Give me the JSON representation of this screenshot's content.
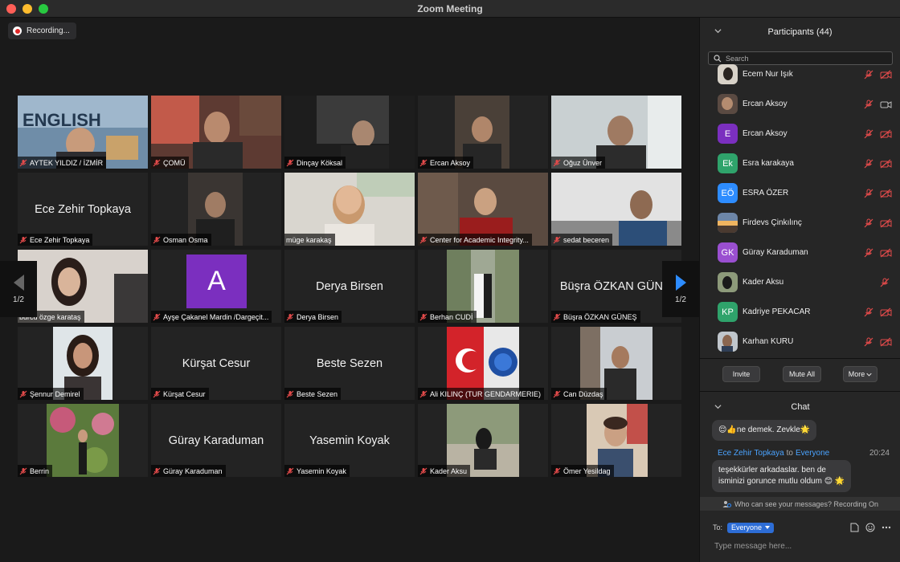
{
  "window": {
    "title": "Zoom Meeting"
  },
  "recording": {
    "label": "Recording..."
  },
  "pager": {
    "left_label": "1/2",
    "right_label": "1/2"
  },
  "colors": {
    "accent": "#2d8cff",
    "active_speaker": "#c6e06a",
    "avatar_purple": "#7b2fbf"
  },
  "tiles": [
    {
      "name": "AYTEK YILDIZ / İZMİR",
      "muted": true
    },
    {
      "name": "ÇOMÜ",
      "muted": true
    },
    {
      "name": "Dinçay Köksal",
      "muted": true
    },
    {
      "name": "Ercan Aksoy",
      "muted": true
    },
    {
      "name": "Oğuz Ünver",
      "muted": true
    },
    {
      "name": "Ece Zehir Topkaya",
      "display": "Ece Zehir Topkaya",
      "muted": true
    },
    {
      "name": "Osman Osma",
      "muted": true
    },
    {
      "name": "müge karakaş",
      "muted": false,
      "active": true
    },
    {
      "name": "Center for Academic Integrity...",
      "muted": true
    },
    {
      "name": "sedat beceren",
      "muted": true
    },
    {
      "name": "burcu özge karataş",
      "muted": false
    },
    {
      "name": "Ayşe Çakanel Mardin /Dargeçit...",
      "avatar": "A",
      "muted": true
    },
    {
      "name": "Derya Birsen",
      "display": "Derya Birsen",
      "muted": true
    },
    {
      "name": "Berhan CUDİ",
      "muted": true
    },
    {
      "name": "Büşra ÖZKAN GÜNEŞ",
      "display": "Büşra ÖZKAN GÜN...",
      "muted": true
    },
    {
      "name": "Şennur Demirel",
      "muted": true
    },
    {
      "name": "Kürşat Cesur",
      "display": "Kürşat Cesur",
      "muted": true
    },
    {
      "name": "Beste Sezen",
      "display": "Beste Sezen",
      "muted": true
    },
    {
      "name": "Ali KILINÇ (TUR GENDARMERIE)",
      "muted": true
    },
    {
      "name": "Can Düzdaş",
      "muted": true
    },
    {
      "name": "Berrin",
      "muted": true
    },
    {
      "name": "Güray Karaduman",
      "display": "Güray Karaduman",
      "muted": true
    },
    {
      "name": "Yasemin Koyak",
      "display": "Yasemin Koyak",
      "muted": true
    },
    {
      "name": "Kader Aksu",
      "muted": true
    },
    {
      "name": "Ömer Yesildag",
      "muted": true
    }
  ],
  "participants": {
    "title": "Participants (44)",
    "search_placeholder": "Search",
    "list": [
      {
        "name": "Ecem Nur Işık",
        "initials": "",
        "color": "#555",
        "video": "off"
      },
      {
        "name": "Ercan Aksoy",
        "initials": "",
        "color": "#5a4a42",
        "video": "on"
      },
      {
        "name": "Ercan Aksoy",
        "initials": "E",
        "color": "#7b2fbf",
        "video": "off"
      },
      {
        "name": "Esra karakaya",
        "initials": "Ek",
        "color": "#2fa36b",
        "video": "off"
      },
      {
        "name": "ESRA ÖZER",
        "initials": "EÖ",
        "color": "#2d8cff",
        "video": "off"
      },
      {
        "name": "Firdevs Çinkılınç",
        "initials": "",
        "color": "#d8a15a",
        "video": "off"
      },
      {
        "name": "Güray Karaduman",
        "initials": "GK",
        "color": "#9a4fd0",
        "video": "off"
      },
      {
        "name": "Kader Aksu",
        "initials": "",
        "color": "#6b6b6b",
        "video": "off"
      },
      {
        "name": "Kadriye PEKACAR",
        "initials": "KP",
        "color": "#2fa36b",
        "video": "off"
      },
      {
        "name": "Karhan KURU",
        "initials": "",
        "color": "#4b5563",
        "video": "off"
      }
    ],
    "buttons": {
      "invite": "Invite",
      "mute_all": "Mute All",
      "more": "More"
    }
  },
  "chat": {
    "title": "Chat",
    "msg1": "😌👍ne demek. Zevkle🌟",
    "sender": "Ece Zehir Topkaya",
    "to_word": "to",
    "recipient": "Everyone",
    "time": "20:24",
    "msg2_line1": "teşekkürler arkadaslar. ben de",
    "msg2_line2": "isminizi gorunce mutlu oldum 😊 🌟",
    "privacy": "Who can see your messages? Recording On",
    "to_label": "To:",
    "to_value": "Everyone",
    "input_placeholder": "Type message here..."
  }
}
